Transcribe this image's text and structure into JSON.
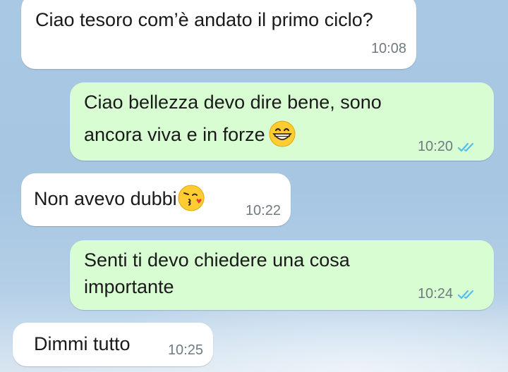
{
  "messages": [
    {
      "direction": "incoming",
      "text": "Ciao tesoro com’è andato il primo ciclo?",
      "time": "10:08"
    },
    {
      "direction": "outgoing",
      "line1": "Ciao bellezza devo dire bene, sono",
      "line2": "ancora viva e in forze",
      "emoji": "grinning-face-emoji",
      "time": "10:20",
      "status": "read-double-check-icon"
    },
    {
      "direction": "incoming",
      "text": "Non avevo dubbi",
      "emoji": "face-blowing-kiss-emoji",
      "time": "10:22"
    },
    {
      "direction": "outgoing",
      "line1": "Senti ti devo chiedere una cosa",
      "line2": "importante",
      "time": "10:24",
      "status": "read-double-check-icon"
    },
    {
      "direction": "incoming",
      "text": "Dimmi tutto",
      "time": "10:25"
    }
  ],
  "colors": {
    "incoming_bubble": "#ffffff",
    "outgoing_bubble": "#d9fdd3",
    "read_ticks": "#53bdeb",
    "timestamp": "#6f7b80",
    "wallpaper": "#a9c8e3"
  }
}
